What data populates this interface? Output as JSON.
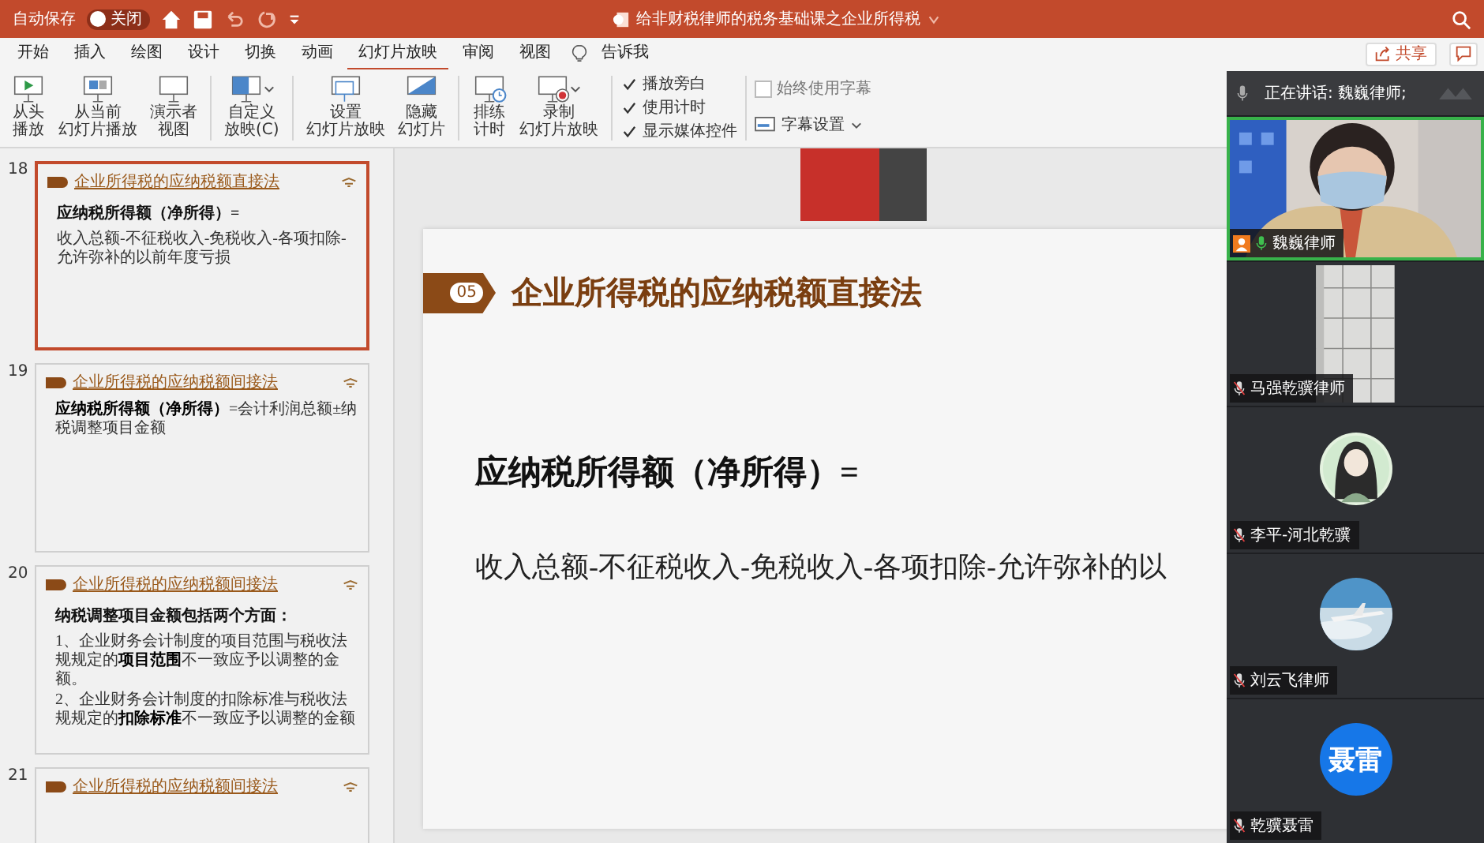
{
  "title_bar": {
    "autosave_label": "自动保存",
    "autosave": {
      "label": "关闭",
      "on": false
    },
    "title": "给非财税律师的税务基础课之企业所得税"
  },
  "tabs": [
    {
      "label": "开始",
      "selected": false
    },
    {
      "label": "插入",
      "selected": false
    },
    {
      "label": "绘图",
      "selected": false
    },
    {
      "label": "设计",
      "selected": false
    },
    {
      "label": "切换",
      "selected": false
    },
    {
      "label": "动画",
      "selected": false
    },
    {
      "label": "幻灯片放映",
      "selected": true
    },
    {
      "label": "审阅",
      "selected": false
    },
    {
      "label": "视图",
      "selected": false
    }
  ],
  "tell_me": "告诉我",
  "share_button": "共享",
  "ribbon": {
    "groups": [
      {
        "buttons": [
          {
            "kind": "play-start",
            "lines": [
              "从头",
              "播放"
            ],
            "dropdown": false
          },
          {
            "kind": "play-current",
            "lines": [
              "从当前",
              "幻灯片播放"
            ],
            "dropdown": false
          },
          {
            "kind": "presenter",
            "lines": [
              "演示者",
              "视图"
            ],
            "dropdown": false
          }
        ]
      },
      {
        "buttons": [
          {
            "kind": "custom",
            "lines": [
              "自定义",
              "放映(C)"
            ],
            "dropdown": true
          }
        ]
      },
      {
        "buttons": [
          {
            "kind": "setup",
            "lines": [
              "设置",
              "幻灯片放映"
            ],
            "dropdown": false
          },
          {
            "kind": "hide",
            "lines": [
              "隐藏",
              "幻灯片"
            ],
            "dropdown": false
          }
        ]
      },
      {
        "buttons": [
          {
            "kind": "rehearse",
            "lines": [
              "排练",
              "计时"
            ],
            "dropdown": false
          },
          {
            "kind": "record",
            "lines": [
              "录制",
              "幻灯片放映"
            ],
            "dropdown": true
          }
        ]
      }
    ],
    "checkboxes": [
      {
        "label": "播放旁白",
        "checked": true
      },
      {
        "label": "使用计时",
        "checked": true
      },
      {
        "label": "显示媒体控件",
        "checked": true
      }
    ],
    "captions": {
      "checkbox": {
        "label": "始终使用字幕",
        "checked": false
      },
      "settings": "字幕设置"
    }
  },
  "slides": [
    {
      "number": "18",
      "selected": true,
      "title": "企业所得税的应纳税额直接法",
      "lines": [
        {
          "kind": "heading",
          "text": "应纳税所得额（净所得）="
        },
        {
          "kind": "body",
          "text": "收入总额-不征税收入-免税收入-各项扣除-允许弥补的以前年度亏损"
        }
      ]
    },
    {
      "number": "19",
      "selected": false,
      "title": "企业所得税的应纳税额间接法",
      "lines": [
        {
          "kind": "body",
          "text": "**应纳税所得额（净所得）**=会计利润总额±纳税调整项目金额"
        }
      ]
    },
    {
      "number": "20",
      "selected": false,
      "title": "企业所得税的应纳税额间接法",
      "lines": [
        {
          "kind": "heading",
          "text": "纳税调整项目金额包括两个方面："
        },
        {
          "kind": "body",
          "text": "1、企业财务会计制度的项目范围与税收法规规定的**项目范围**不一致应予以调整的金额。"
        },
        {
          "kind": "body",
          "text": "2、企业财务会计制度的扣除标准与税收法规规定的**扣除标准**不一致应予以调整的金额"
        }
      ]
    },
    {
      "number": "21",
      "selected": false,
      "title": "企业所得税的应纳税额间接法"
    }
  ],
  "main_slide": {
    "badge": "05",
    "title": "企业所得税的应纳税额直接法",
    "heading": "应纳税所得额（净所得）=",
    "body": "收入总额-不征税收入-免税收入-各项扣除-允许弥补的以"
  },
  "meeting": {
    "speaking": "正在讲话: 魏巍律师;",
    "participants": [
      {
        "name": "魏巍律师",
        "kind": "video",
        "active": true,
        "host": true,
        "muted": false
      },
      {
        "name": "马强乾骥律师",
        "kind": "wall",
        "active": false,
        "host": false,
        "muted": true
      },
      {
        "name": "李平-河北乾骥",
        "kind": "avatar-figure",
        "active": false,
        "host": false,
        "muted": true
      },
      {
        "name": "刘云飞律师",
        "kind": "avatar-sky",
        "active": false,
        "host": false,
        "muted": true
      },
      {
        "name": "乾骥聂雷",
        "kind": "initials",
        "initials": "聂雷",
        "active": false,
        "host": false,
        "muted": true
      }
    ]
  }
}
